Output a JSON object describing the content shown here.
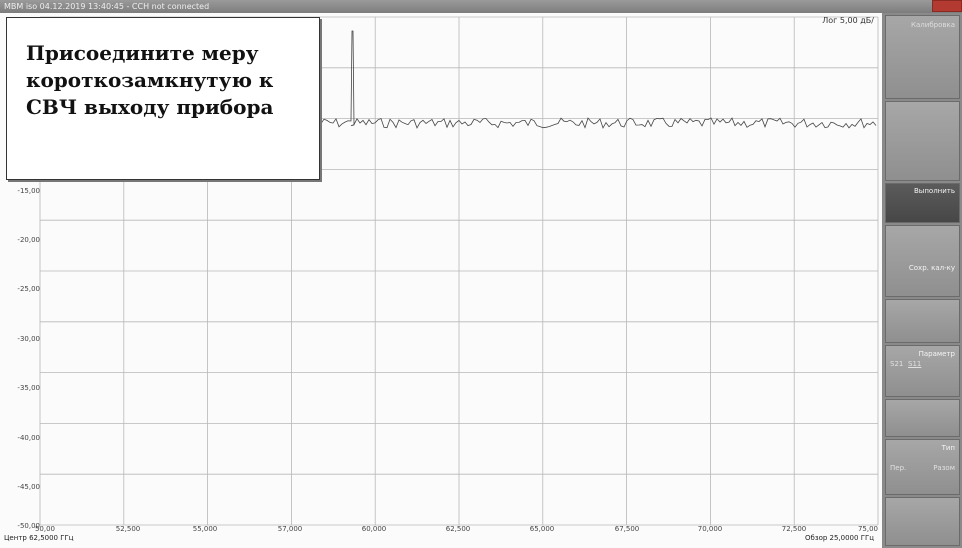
{
  "window": {
    "title": "MBM iso    04.12.2019 13:40:45  -  ССН not connected"
  },
  "plot": {
    "scale_label": "Лог 5,00 дБ/",
    "y_ticks": [
      "-15,00",
      "-20,00",
      "-25,00",
      "-30,00",
      "-35,00",
      "-40,00",
      "-45,00",
      "-50,00"
    ],
    "x_ticks": [
      "50,00",
      "52,500",
      "55,000",
      "57,000",
      "60,000",
      "62,500",
      "65,000",
      "67,500",
      "70,000",
      "72,500",
      "75,00"
    ],
    "center_label": "Центр 62,5000 ГГц",
    "span_label": "Обзор 25,0000 ГГц"
  },
  "dialog": {
    "line1": "Присоедините меру",
    "line2": "короткозамкнутую к",
    "line3": "СВЧ выходу прибора"
  },
  "softkeys": {
    "header": "Калибровка",
    "execute": "Выполнить",
    "save_kit": "Сохр. кал-ку",
    "param": "Параметр",
    "param_s21": "S21",
    "param_s11": "S11",
    "type": "Тип",
    "type_trans": "Пер.",
    "type_refl": "Разом"
  }
}
